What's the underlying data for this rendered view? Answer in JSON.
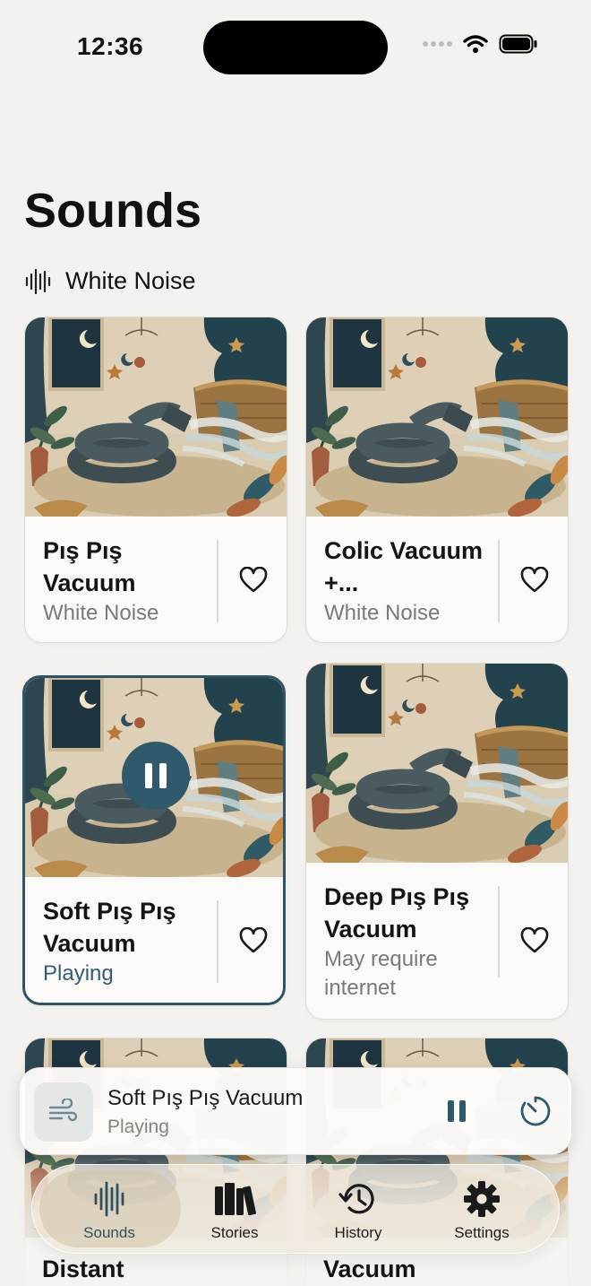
{
  "status": {
    "time": "12:36"
  },
  "page": {
    "title": "Sounds"
  },
  "section": {
    "label": "White Noise"
  },
  "cards": [
    {
      "title": "Pış Pış Vacuum",
      "subtitle": "White Noise",
      "state": "normal"
    },
    {
      "title": "Colic Vacuum +...",
      "subtitle": "White Noise",
      "state": "normal"
    },
    {
      "title": "Soft Pış Pış Vacuum",
      "subtitle": "Playing",
      "state": "playing"
    },
    {
      "title": "Deep Pış Pış Vacuum",
      "subtitle": "May require internet",
      "state": "normal"
    },
    {
      "title": "Distant",
      "subtitle": "",
      "state": "partial"
    },
    {
      "title": "Vacuum",
      "subtitle": "",
      "state": "partial"
    }
  ],
  "mini_player": {
    "title": "Soft Pış Pış Vacuum",
    "status": "Playing"
  },
  "tabs": [
    {
      "label": "Sounds",
      "icon": "waveform-icon",
      "active": true
    },
    {
      "label": "Stories",
      "icon": "books-icon",
      "active": false
    },
    {
      "label": "History",
      "icon": "history-clock-icon",
      "active": false
    },
    {
      "label": "Settings",
      "icon": "gear-icon",
      "active": false
    }
  ],
  "colors": {
    "accent": "#2f5a6c",
    "background": "#f4f2ee",
    "card": "#fbfaf8",
    "muted_text": "#7a7a76"
  }
}
